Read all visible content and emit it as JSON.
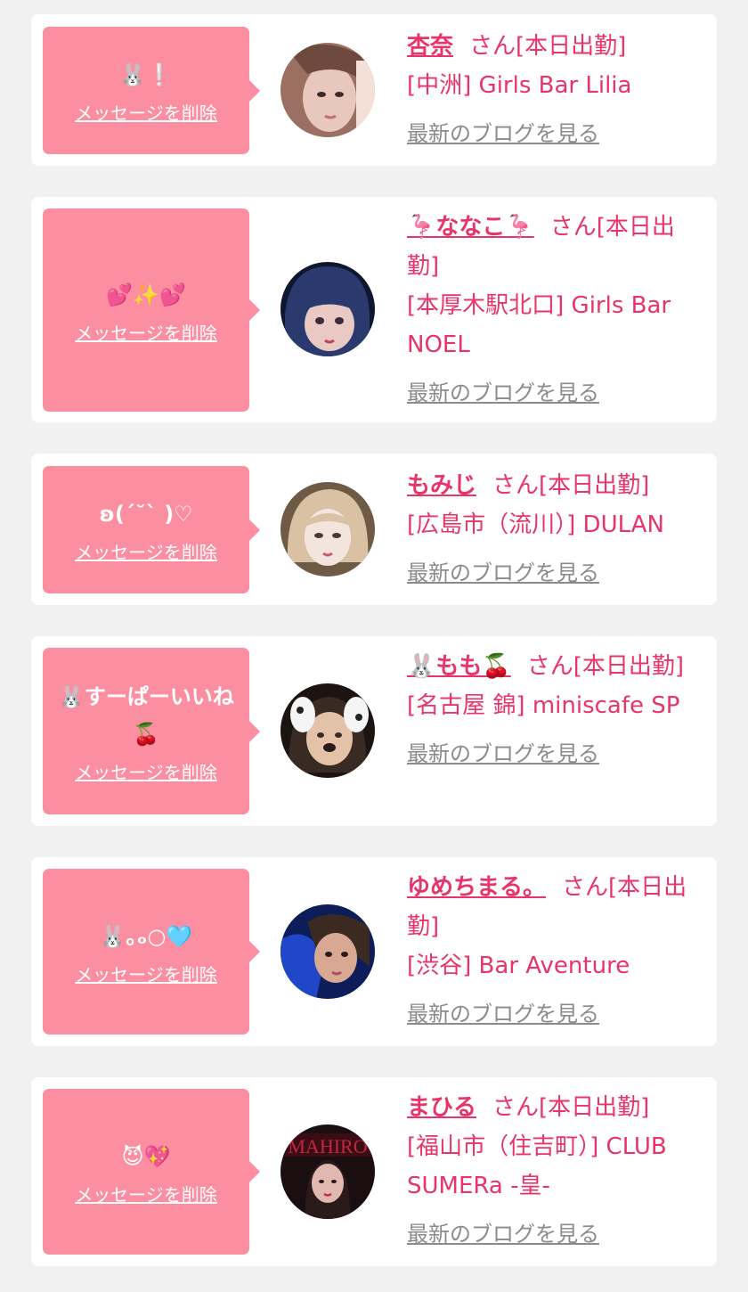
{
  "cards": [
    {
      "message": "🐰❕",
      "delete_label": "メッセージを削除",
      "name": "杏奈",
      "suffix": "さん[本日出勤]",
      "shop": "[中洲] Girls Bar Lilia",
      "blog_label": "最新のブログを見る",
      "avatar_colors": [
        "#e8c7bd",
        "#9b6f62",
        "#f4e0d6"
      ]
    },
    {
      "message": "💕✨💕",
      "delete_label": "メッセージを削除",
      "name": "🦩ななこ🦩",
      "suffix": "さん[本日出勤]",
      "shop": "[本厚木駅北口] Girls Bar NOEL",
      "blog_label": "最新のブログを見る",
      "avatar_colors": [
        "#2b3a6e",
        "#0f1630",
        "#e8c9c4"
      ]
    },
    {
      "message": "ʚ(ˊ˘ˋ )♡",
      "delete_label": "メッセージを削除",
      "name": "もみじ",
      "suffix": "さん[本日出勤]",
      "shop": "[広島市（流川）] DULAN",
      "blog_label": "最新のブログを見る",
      "avatar_colors": [
        "#d9c2a3",
        "#6e5a45",
        "#f2e6dc"
      ]
    },
    {
      "message": "🐰すーぱーいいね🍒",
      "delete_label": "メッセージを削除",
      "name": "🐰もも🍒",
      "suffix": "さん[本日出勤]",
      "shop": "[名古屋 錦] miniscafe SP",
      "blog_label": "最新のブログを見る",
      "avatar_colors": [
        "#3a2a24",
        "#1c1410",
        "#e3c2a8"
      ]
    },
    {
      "message": "🐰｡ₒ○🩵",
      "delete_label": "メッセージを削除",
      "name": "ゆめちまる。",
      "suffix": "さん[本日出勤]",
      "shop": "[渋谷] Bar Aventure",
      "blog_label": "最新のブログを見る",
      "avatar_colors": [
        "#1f47c8",
        "#0d1d5a",
        "#d9a892"
      ]
    },
    {
      "message": "😈💖",
      "delete_label": "メッセージを削除",
      "name": "まひる",
      "suffix": "さん[本日出勤]",
      "shop": "[福山市（住吉町）] CLUB SUMERa -皇-",
      "blog_label": "最新のブログを見る",
      "avatar_colors": [
        "#1a0e10",
        "#7a1020",
        "#e0b8b0"
      ],
      "avatar_text": "MAHIRO"
    }
  ]
}
